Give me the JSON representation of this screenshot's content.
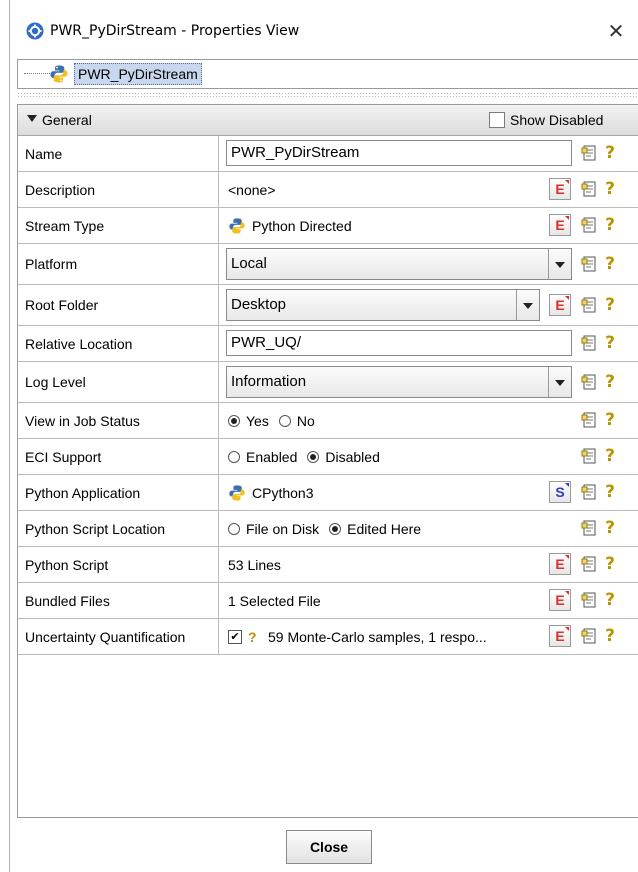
{
  "window": {
    "title": "PWR_PyDirStream - Properties View",
    "close_symbol": "✕",
    "app_icon": "gear-icon",
    "accent": "#2f6bc7"
  },
  "tree": {
    "node_label": "PWR_PyDirStream",
    "node_icon": "python-icon"
  },
  "group": {
    "label": "General",
    "show_disabled_label": "Show Disabled",
    "show_disabled_checked": false
  },
  "rows": {
    "name": {
      "label": "Name",
      "value": "PWR_PyDirStream"
    },
    "description": {
      "label": "Description",
      "value": "<none>"
    },
    "stream_type": {
      "label": "Stream Type",
      "value": "Python Directed"
    },
    "platform": {
      "label": "Platform",
      "value": "Local"
    },
    "root_folder": {
      "label": "Root Folder",
      "value": "Desktop"
    },
    "relative_location": {
      "label": "Relative Location",
      "value": "PWR_UQ/"
    },
    "log_level": {
      "label": "Log Level",
      "value": "Information"
    },
    "view_job_status": {
      "label": "View in Job Status",
      "opt1": "Yes",
      "opt2": "No",
      "selected": "Yes"
    },
    "eci_support": {
      "label": "ECI Support",
      "opt1": "Enabled",
      "opt2": "Disabled",
      "selected": "Disabled"
    },
    "python_application": {
      "label": "Python Application",
      "value": "CPython3"
    },
    "python_script_location": {
      "label": "Python Script Location",
      "opt1": "File on Disk",
      "opt2": "Edited Here",
      "selected": "Edited Here"
    },
    "python_script": {
      "label": "Python Script",
      "value": "53 Lines"
    },
    "bundled_files": {
      "label": "Bundled Files",
      "value": "1 Selected File"
    },
    "uq": {
      "label": "Uncertainty Quantification",
      "value": "59 Monte-Carlo samples, 1 respo...",
      "checked": true
    }
  },
  "buttons": {
    "edit_glyph": "E",
    "script_glyph": "S",
    "help_glyph": "?",
    "close_label": "Close"
  },
  "colors": {
    "edit_red": "#d7322a",
    "script_blue": "#2a3fbf",
    "help_gold": "#b89400",
    "selection_bg": "#c7d8ee"
  }
}
